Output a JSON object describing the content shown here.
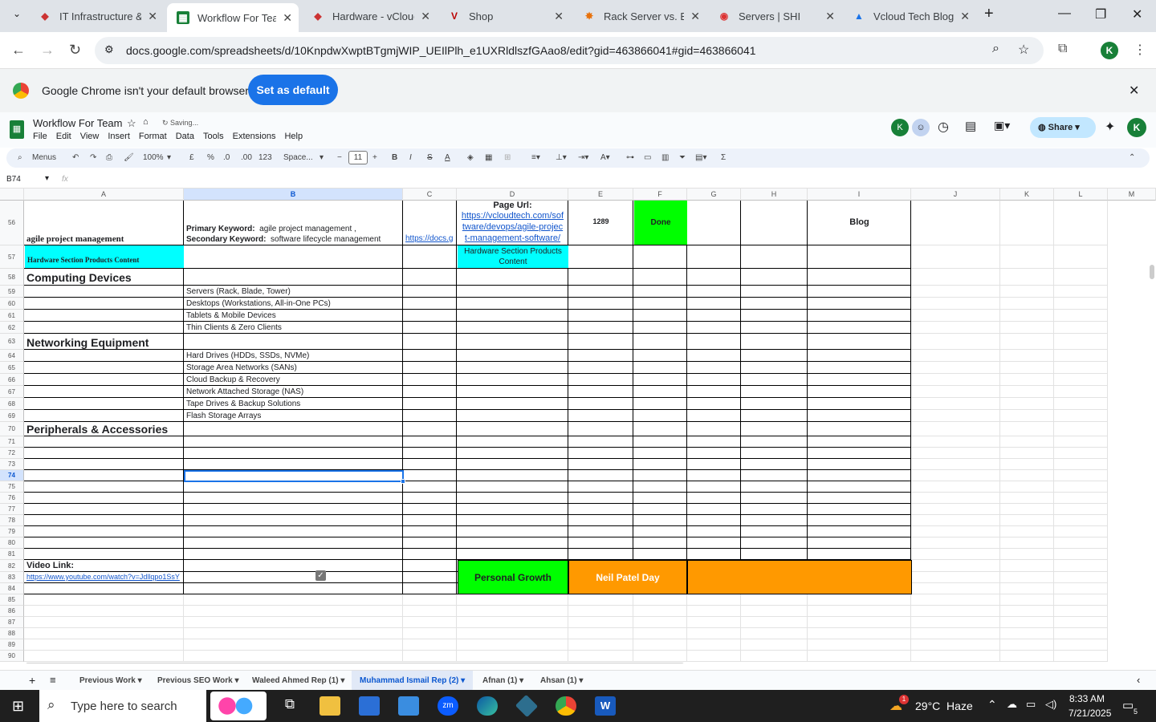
{
  "browser": {
    "tabs": [
      {
        "title": "IT Infrastructure &",
        "icon": "sheets-icon"
      },
      {
        "title": "Workflow For Team",
        "icon": "sheets-icon"
      },
      {
        "title": "Hardware - vCloud",
        "icon": "vcloud-icon"
      },
      {
        "title": "Shop",
        "icon": "v-icon"
      },
      {
        "title": "Rack Server vs. Bla",
        "icon": "ahrefs-icon"
      },
      {
        "title": "Servers | SHI",
        "icon": "shi-icon"
      },
      {
        "title": "Vcloud Tech Blog",
        "icon": "drive-icon"
      }
    ],
    "url": "docs.google.com/spreadsheets/d/10KnpdwXwptBTgmjWIP_UEIlPlh_e1UXRldlszfGAao8/edit?gid=463866041#gid=463866041",
    "banner_text": "Google Chrome isn't your default browser",
    "banner_button": "Set as default"
  },
  "sheets": {
    "title": "Workflow For Team",
    "status": "Saving...",
    "menus": [
      "File",
      "Edit",
      "View",
      "Insert",
      "Format",
      "Data",
      "Tools",
      "Extensions",
      "Help"
    ],
    "share": "Share",
    "toolbar": {
      "menus_label": "Menus",
      "zoom": "100%",
      "currency": "£",
      "percent": "%",
      "dec_less": ".0",
      "dec_more": ".00",
      "numfmt": "123",
      "font": "Space...",
      "size": "11"
    },
    "name_box": "B74",
    "fx": "fx",
    "columns": [
      "A",
      "B",
      "C",
      "D",
      "E",
      "F",
      "G",
      "H",
      "I",
      "J",
      "K",
      "L",
      "M"
    ],
    "rows": [
      "56",
      "57",
      "58",
      "59",
      "60",
      "61",
      "62",
      "63",
      "64",
      "65",
      "66",
      "67",
      "68",
      "69",
      "70",
      "71",
      "72",
      "73",
      "74",
      "75",
      "76",
      "77",
      "78",
      "79",
      "80",
      "81",
      "82",
      "83",
      "84",
      "85",
      "86",
      "87",
      "88",
      "89",
      "90"
    ],
    "r56": {
      "a": "agile project management",
      "b1_label": "Primary Keyword:",
      "b1_val": "agile project management ,",
      "b2_label": "Secondary Keyword:",
      "b2_val": "software lifecycle management",
      "c": "https://docs.g",
      "d_title": "Page Url:",
      "d_link": [
        "https://vcloudtech.com/sof",
        "tware/devops/agile-projec",
        "t-management-software/"
      ],
      "e": "1289",
      "f": "Done",
      "i": "Blog"
    },
    "r57": {
      "a": "Hardware Section Products Content",
      "d": [
        "Hardware Section Products",
        "Content"
      ]
    },
    "h58": "Computing Devices",
    "items1": [
      "Servers (Rack, Blade, Tower)",
      "Desktops (Workstations, All-in-One PCs)",
      "Tablets & Mobile Devices",
      "Thin Clients & Zero Clients"
    ],
    "h63": "Networking Equipment",
    "items2": [
      "Hard Drives (HDDs, SSDs, NVMe)",
      "Storage Area Networks (SANs)",
      "Cloud Backup & Recovery",
      "Network Attached Storage (NAS)",
      "Tape Drives & Backup Solutions",
      "Flash Storage Arrays"
    ],
    "h70": "Peripherals & Accessories",
    "video_label": "Video Link:",
    "video_link": "https://www.youtube.com/watch?v=Jdllqpo1SsY",
    "personal": "Personal Growth",
    "neil": "Neil Patel Day",
    "sheet_tabs": [
      "Previous Work",
      "Previous SEO Work",
      "Waleed Ahmed Rep (1)",
      "Muhammad Ismail Rep (2)",
      "Afnan (1)",
      "Ahsan (1)"
    ]
  },
  "taskbar": {
    "search": "Type here to search",
    "weather": "29°C  Haze",
    "time": "8:33 AM",
    "date": "7/21/2025",
    "notif": "5",
    "weather_badge": "1"
  },
  "colors": {
    "cyan": "#00ffff",
    "green": "#00ff00",
    "orange": "#ff9900",
    "link": "#1155cc",
    "accent": "#1a73e8"
  }
}
